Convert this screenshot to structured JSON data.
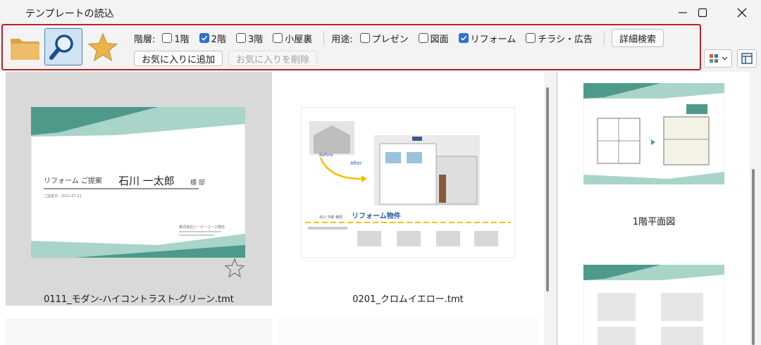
{
  "window": {
    "title": "テンプレートの読込"
  },
  "toolbar": {
    "folder_icon": "folder-icon",
    "search_icon": "magnifier-icon",
    "favorite_icon": "star-icon",
    "floor_label": "階層:",
    "floors": [
      {
        "label": "1階",
        "checked": false
      },
      {
        "label": "2階",
        "checked": true
      },
      {
        "label": "3階",
        "checked": false
      },
      {
        "label": "小屋裏",
        "checked": false
      }
    ],
    "usage_label": "用途:",
    "usages": [
      {
        "label": "プレゼン",
        "checked": false
      },
      {
        "label": "図面",
        "checked": false
      },
      {
        "label": "リフォーム",
        "checked": true
      },
      {
        "label": "チラシ・広告",
        "checked": false
      }
    ],
    "detail_search": "詳細検索",
    "add_favorite": "お気に入りに追加",
    "remove_favorite": "お気に入りを削除"
  },
  "templates": [
    {
      "filename": "0111_モダン-ハイコントラスト-グリーン.tmt",
      "selected": true,
      "preview": {
        "heading": "リフォーム ご提案",
        "name": "石川 一太郎",
        "honorific": "様 邸",
        "date": "ご提案日：2021.07.21",
        "company": "株式会社シーピーユー工務店"
      }
    },
    {
      "filename": "0201_クロムイエロー.tmt",
      "selected": false,
      "preview": {
        "before": "Before",
        "after": "After",
        "title": "リフォーム物件",
        "customer": "石川 次郎 様邸"
      }
    }
  ],
  "preview_pane": {
    "pages": [
      {
        "caption": "1階平面図"
      },
      {
        "caption": ""
      }
    ]
  },
  "colors": {
    "accent": "#b3262c",
    "teal": "#4e9a8a",
    "teal_light": "#a8d4ca",
    "yellow": "#f2c200",
    "check": "#2f6fd0"
  }
}
